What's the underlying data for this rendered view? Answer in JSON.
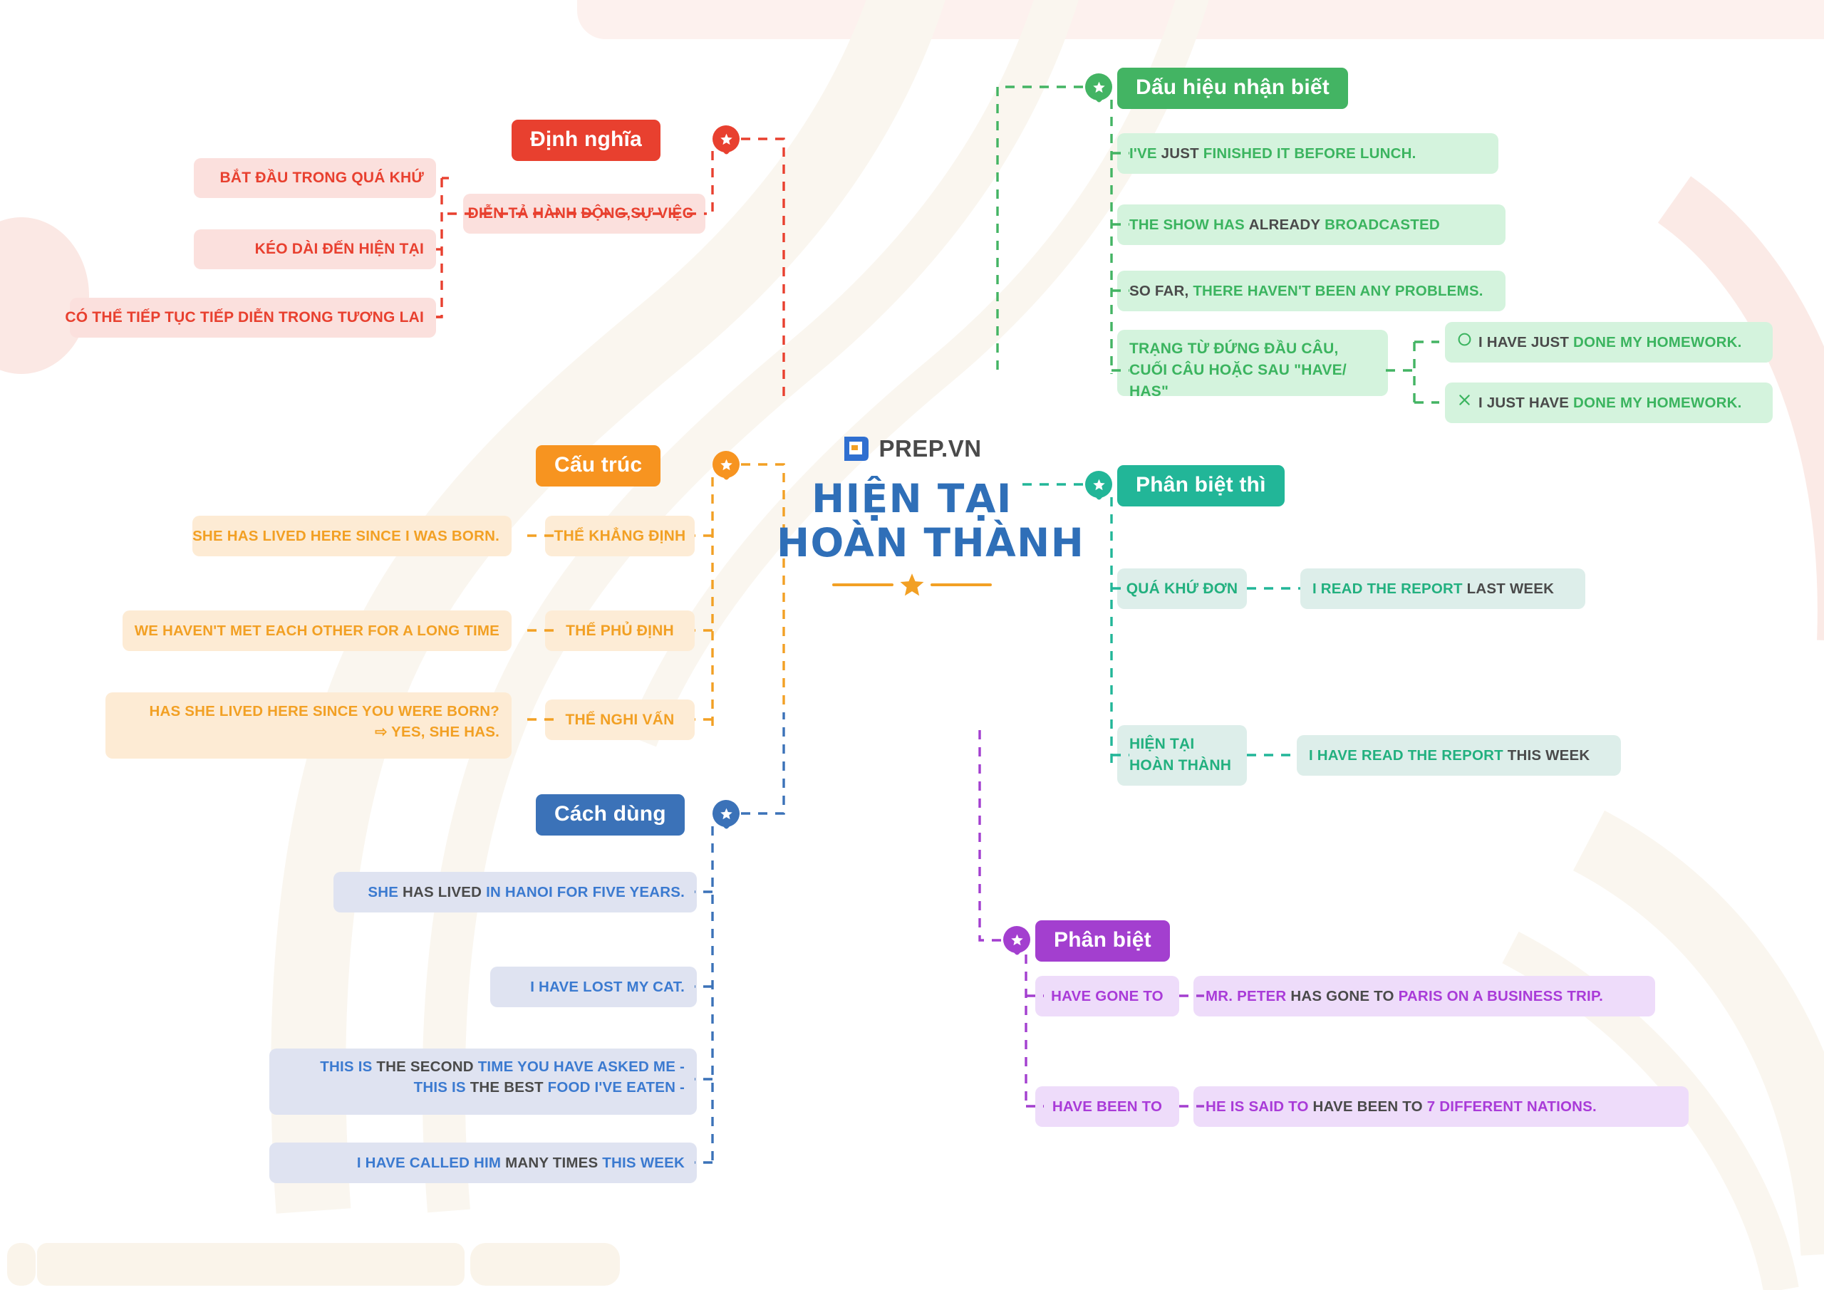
{
  "centre": {
    "logo_word": "PREP.VN",
    "logo_icon": "prep-logo-mark",
    "title_line1": "HIỆN TẠI",
    "title_line2": "HOÀN THÀNH",
    "divider_icon": "star-icon"
  },
  "branches": {
    "dinh_nghia": {
      "label": "Định nghĩa",
      "color": "#e8402f",
      "items": [
        {
          "text": "BẮT ĐẦU TRONG QUÁ KHỨ"
        },
        {
          "text": "KÉO DÀI ĐẾN HIỆN TẠI"
        },
        {
          "text": "CÓ THỂ TIẾP TỤC TIẾP DIỄN TRONG TƯƠNG LAI"
        },
        {
          "text": "DIỄN TẢ HÀNH ĐỘNG,SỰ VIỆC"
        }
      ]
    },
    "cau_truc": {
      "label": "Cấu trúc",
      "color": "#f79420",
      "items": [
        {
          "form": "THỂ KHẲNG ĐỊNH",
          "example": "SHE HAS LIVED HERE SINCE I WAS BORN."
        },
        {
          "form": "THỂ PHỦ ĐỊNH",
          "example": "WE HAVEN'T MET EACH OTHER FOR A LONG TIME"
        },
        {
          "form": "THỂ NGHI VẤN",
          "example_l1": "HAS SHE LIVED HERE SINCE YOU WERE BORN?",
          "example_l2": "⇨ YES, SHE HAS."
        }
      ]
    },
    "cach_dung": {
      "label": "Cách dùng",
      "color": "#3b72b8",
      "items": [
        {
          "a": "SHE",
          "b": "HAS LIVED",
          "c": "IN HANOI FOR FIVE YEARS."
        },
        {
          "a": "I HAVE LOST MY CAT.",
          "b": "",
          "c": ""
        },
        {
          "l1a": "THIS IS",
          "l1b": "THE SECOND",
          "l1c": "TIME YOU HAVE ASKED ME -",
          "l2a": "THIS IS",
          "l2b": "THE BEST",
          "l2c": "FOOD I'VE EATEN -"
        },
        {
          "a": "I HAVE CALLED HIM",
          "b": "MANY TIMES",
          "c": "THIS WEEK"
        }
      ]
    },
    "dau_hieu": {
      "label": "Dấu hiệu nhận biết",
      "color": "#43b463",
      "items": [
        {
          "a": "I'VE",
          "b": "JUST",
          "c": "FINISHED IT BEFORE LUNCH."
        },
        {
          "a": "THE SHOW HAS",
          "b": "ALREADY",
          "c": "BROADCASTED"
        },
        {
          "a": "",
          "b": "SO FAR,",
          "c": "THERE HAVEN'T BEEN ANY PROBLEMS."
        }
      ],
      "adverb_note_l1": "TRẠNG TỪ ĐỨNG ĐẦU CÂU,",
      "adverb_note_l2": "CUỐI CÂU HOẶC SAU \"HAVE/ HAS\"",
      "adverb_examples": [
        {
          "mark": "correct-circle-icon",
          "b": "I HAVE JUST",
          "c": "DONE MY HOMEWORK."
        },
        {
          "mark": "wrong-cross-icon",
          "b": "I JUST HAVE",
          "c": "DONE MY HOMEWORK."
        }
      ]
    },
    "phan_biet_thi": {
      "label": "Phân biệt thì",
      "color": "#22b698",
      "items": [
        {
          "tense": "QUÁ KHỨ ĐƠN",
          "a": "I READ THE REPORT",
          "b": "LAST WEEK"
        },
        {
          "tense_l1": "HIỆN TẠI",
          "tense_l2": "HOÀN THÀNH",
          "a": "I HAVE READ THE REPORT",
          "b": "THIS WEEK"
        }
      ]
    },
    "phan_biet": {
      "label": "Phân biệt",
      "color": "#a33fcf",
      "items": [
        {
          "form": "HAVE GONE TO",
          "a": "MR. PETER",
          "b": "HAS GONE TO",
          "c": "PARIS ON A BUSINESS TRIP."
        },
        {
          "form": "HAVE BEEN TO",
          "a": "HE IS SAID TO",
          "b": "HAVE BEEN TO",
          "c": "7 DIFFERENT NATIONS."
        }
      ]
    }
  }
}
